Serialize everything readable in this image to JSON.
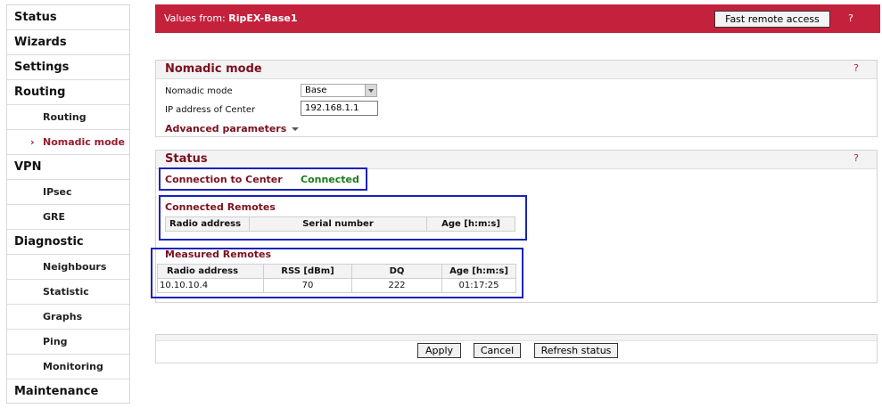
{
  "sidebar": {
    "items": [
      {
        "label": "Status"
      },
      {
        "label": "Wizards"
      },
      {
        "label": "Settings"
      },
      {
        "label": "Routing"
      },
      {
        "label": "Routing"
      },
      {
        "label": "Nomadic mode"
      },
      {
        "label": "VPN"
      },
      {
        "label": "IPsec"
      },
      {
        "label": "GRE"
      },
      {
        "label": "Diagnostic"
      },
      {
        "label": "Neighbours"
      },
      {
        "label": "Statistic"
      },
      {
        "label": "Graphs"
      },
      {
        "label": "Ping"
      },
      {
        "label": "Monitoring"
      },
      {
        "label": "Maintenance"
      }
    ],
    "active_marker": "›"
  },
  "header": {
    "prefix": "Values from: ",
    "device": "RipEX-Base1",
    "fast_remote_label": "Fast remote access",
    "help": "?"
  },
  "nomadic": {
    "title": "Nomadic mode",
    "help": "?",
    "mode_label": "Nomadic mode",
    "mode_value": "Base",
    "ip_label": "IP address of Center",
    "ip_value": "192.168.1.1",
    "advanced_label": "Advanced parameters"
  },
  "status": {
    "title": "Status",
    "help": "?",
    "connection_label": "Connection to Center",
    "connection_value": "Connected",
    "connected_remotes": {
      "title": "Connected Remotes",
      "headers": [
        "Radio address",
        "Serial number",
        "Age [h:m:s]"
      ]
    },
    "measured_remotes": {
      "title": "Measured Remotes",
      "headers": [
        "Radio address",
        "RSS [dBm]",
        "DQ",
        "Age [h:m:s]"
      ],
      "rows": [
        [
          "10.10.10.4",
          "70",
          "222",
          "01:17:25"
        ]
      ]
    }
  },
  "actions": {
    "apply": "Apply",
    "cancel": "Cancel",
    "refresh": "Refresh status"
  },
  "colors": {
    "header_bg": "#c4213d",
    "title_text": "#7a1020",
    "connected_text": "#1b7a1b",
    "highlight_box": "#1a23b8"
  }
}
